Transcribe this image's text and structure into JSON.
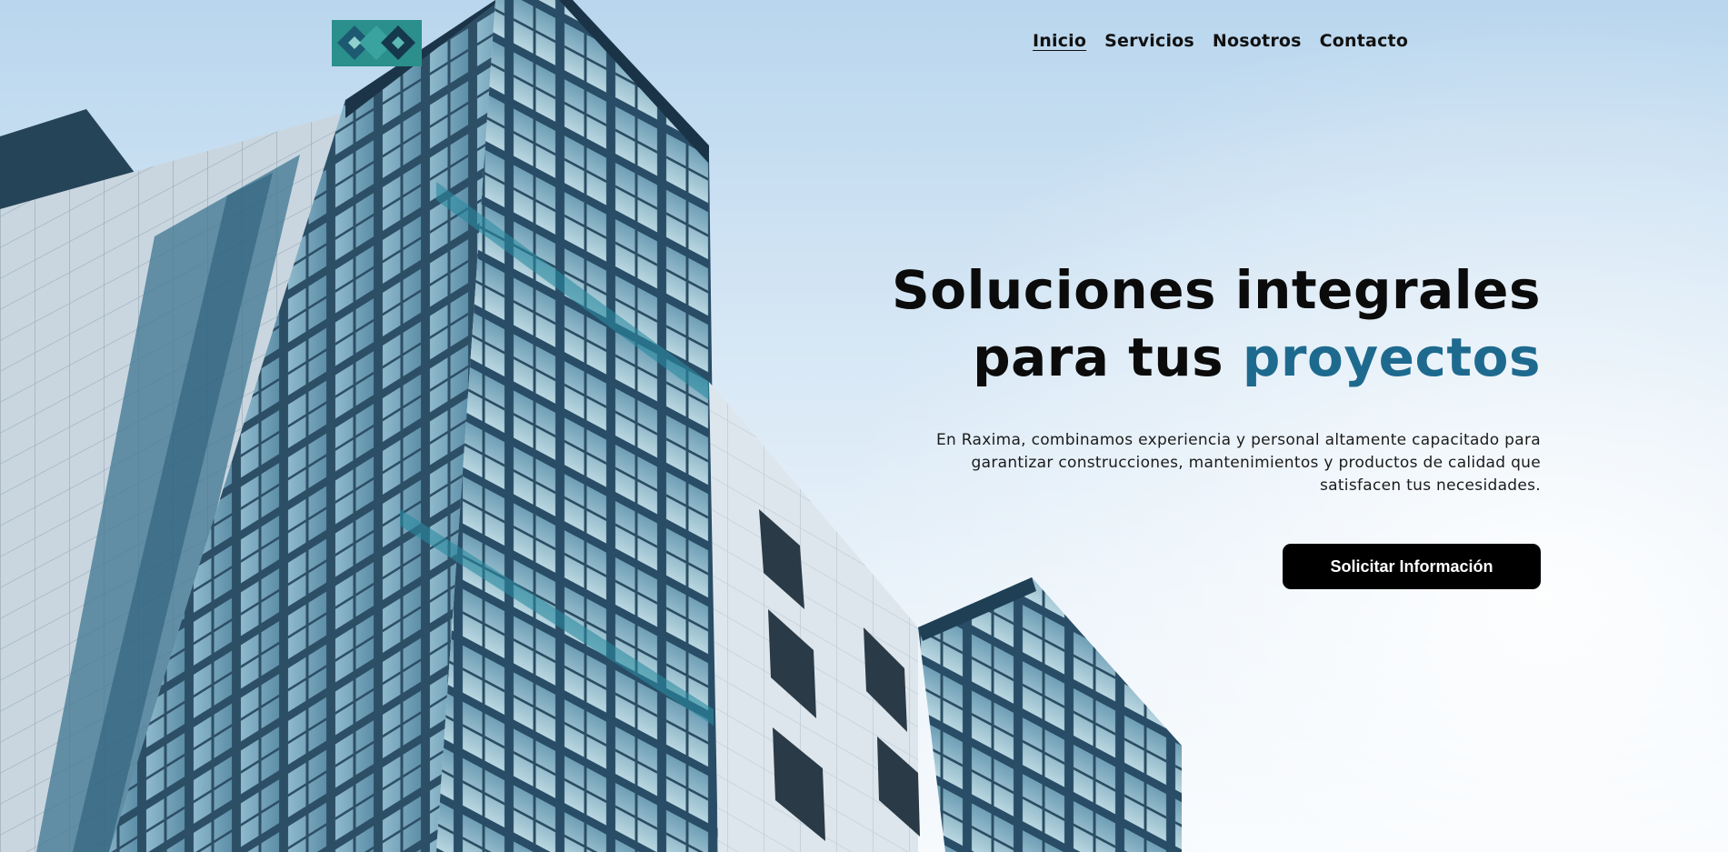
{
  "brand": {
    "logo_icon": "interlocking-diamonds-logo-icon",
    "colors": {
      "accent": "#1e6a8f",
      "logo_teal": "#3aa3a0",
      "logo_dark": "#15384d"
    }
  },
  "nav": {
    "items": [
      {
        "label": "Inicio",
        "active": true
      },
      {
        "label": "Servicios",
        "active": false
      },
      {
        "label": "Nosotros",
        "active": false
      },
      {
        "label": "Contacto",
        "active": false
      }
    ]
  },
  "hero": {
    "headline_line1": "Soluciones integrales",
    "headline_line2_plain": "para tus ",
    "headline_line2_accent": "proyectos",
    "subtext": "En Raxima, combinamos experiencia y personal altamente capacitado para garantizar construcciones, mantenimientos y productos de calidad que satisfacen tus necesidades.",
    "cta_label": "Solicitar Información",
    "background_image": "modern-glass-building-photo"
  }
}
